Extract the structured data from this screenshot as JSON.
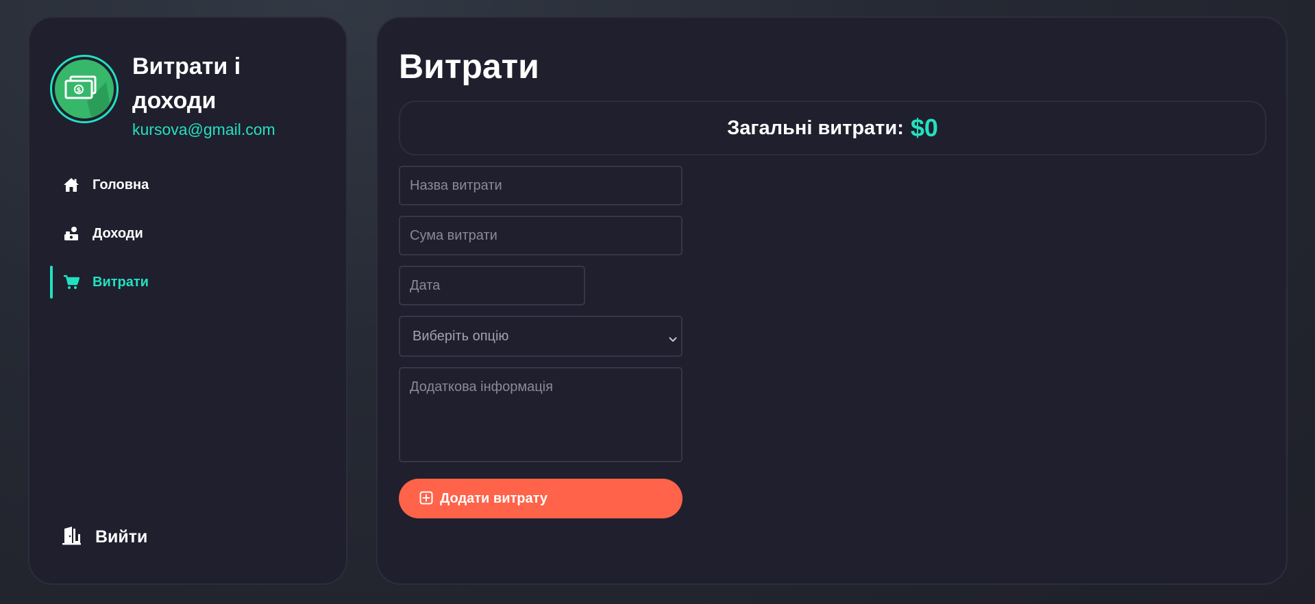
{
  "sidebar": {
    "profile": {
      "title": "Витрати і доходи",
      "email": "kursova@gmail.com",
      "avatar_icon": "money-bill-icon"
    },
    "items": [
      {
        "label": "Головна",
        "icon": "home-icon",
        "active": false
      },
      {
        "label": "Доходи",
        "icon": "money-bag-icon",
        "active": false
      },
      {
        "label": "Витрати",
        "icon": "cart-icon",
        "active": true
      }
    ],
    "logout_label": "Вийти"
  },
  "main": {
    "title": "Витрати",
    "total": {
      "label": "Загальні витрати:",
      "value": "$0"
    },
    "form": {
      "name_placeholder": "Назва витрати",
      "amount_placeholder": "Сума витрати",
      "date_placeholder": "Дата",
      "category_selected": "Виберіть опцію",
      "info_placeholder": "Додаткова інформація",
      "submit_label": "Додати витрату"
    }
  },
  "colors": {
    "accent": "#22e1c0",
    "button": "#ff6349",
    "panel": "#201f2e"
  }
}
